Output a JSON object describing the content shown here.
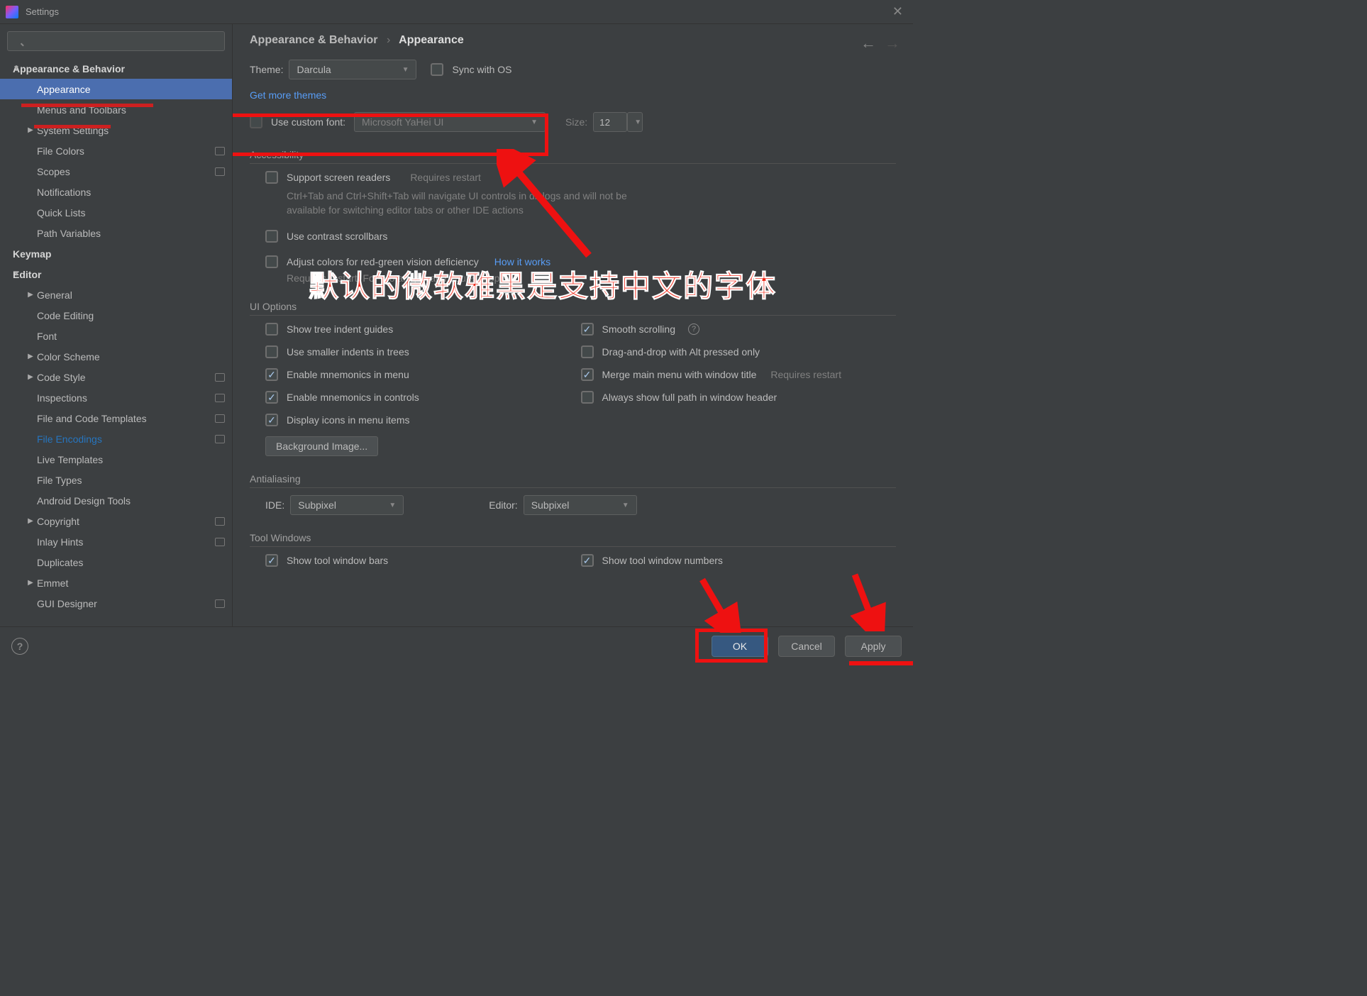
{
  "window": {
    "title": "Settings"
  },
  "sidebar": {
    "items": [
      {
        "label": "Appearance & Behavior",
        "lvl": 0,
        "chev": "down"
      },
      {
        "label": "Appearance",
        "lvl": 1,
        "selected": true
      },
      {
        "label": "Menus and Toolbars",
        "lvl": 1
      },
      {
        "label": "System Settings",
        "lvl": 1,
        "chev": "right"
      },
      {
        "label": "File Colors",
        "lvl": 1,
        "badge": true
      },
      {
        "label": "Scopes",
        "lvl": 1,
        "badge": true
      },
      {
        "label": "Notifications",
        "lvl": 1
      },
      {
        "label": "Quick Lists",
        "lvl": 1
      },
      {
        "label": "Path Variables",
        "lvl": 1
      },
      {
        "label": "Keymap",
        "lvl": 0
      },
      {
        "label": "Editor",
        "lvl": 0,
        "chev": "down"
      },
      {
        "label": "General",
        "lvl": 1,
        "chev": "right"
      },
      {
        "label": "Code Editing",
        "lvl": 1
      },
      {
        "label": "Font",
        "lvl": 1
      },
      {
        "label": "Color Scheme",
        "lvl": 1,
        "chev": "right"
      },
      {
        "label": "Code Style",
        "lvl": 1,
        "chev": "right",
        "badge": true
      },
      {
        "label": "Inspections",
        "lvl": 1,
        "badge": true
      },
      {
        "label": "File and Code Templates",
        "lvl": 1,
        "badge": true
      },
      {
        "label": "File Encodings",
        "lvl": 1,
        "badge": true,
        "highlighted": true
      },
      {
        "label": "Live Templates",
        "lvl": 1
      },
      {
        "label": "File Types",
        "lvl": 1
      },
      {
        "label": "Android Design Tools",
        "lvl": 1
      },
      {
        "label": "Copyright",
        "lvl": 1,
        "chev": "right",
        "badge": true
      },
      {
        "label": "Inlay Hints",
        "lvl": 1,
        "badge": true
      },
      {
        "label": "Duplicates",
        "lvl": 1
      },
      {
        "label": "Emmet",
        "lvl": 1,
        "chev": "right"
      },
      {
        "label": "GUI Designer",
        "lvl": 1,
        "badge": true
      }
    ]
  },
  "breadcrumb": {
    "parent": "Appearance & Behavior",
    "current": "Appearance"
  },
  "theme": {
    "label": "Theme:",
    "value": "Darcula",
    "sync": "Sync with OS",
    "more": "Get more themes"
  },
  "customFont": {
    "label": "Use custom font:",
    "value": "Microsoft YaHei UI",
    "sizeLabel": "Size:",
    "size": "12"
  },
  "accessibility": {
    "title": "Accessibility",
    "screenReaders": "Support screen readers",
    "requiresRestart": "Requires restart",
    "screenReadersHint": "Ctrl+Tab and Ctrl+Shift+Tab will navigate UI controls in dialogs and will not be available for switching editor tabs or other IDE actions",
    "contrast": "Use contrast scrollbars",
    "adjustColors": "Adjust colors for red-green vision deficiency",
    "howItWorks": "How it works",
    "adjustHint": "Requires restart. For protanopia and deuteranopia."
  },
  "uiOptions": {
    "title": "UI Options",
    "treeIndent": "Show tree indent guides",
    "smallerIndents": "Use smaller indents in trees",
    "mnemonicsMenu": "Enable mnemonics in menu",
    "mnemonicsControls": "Enable mnemonics in controls",
    "displayIcons": "Display icons in menu items",
    "smoothScrolling": "Smooth scrolling",
    "dragDrop": "Drag-and-drop with Alt pressed only",
    "mergeMenu": "Merge main menu with window title",
    "fullPath": "Always show full path in window header",
    "bgImage": "Background Image..."
  },
  "antialiasing": {
    "title": "Antialiasing",
    "ide": "IDE:",
    "ideVal": "Subpixel",
    "editor": "Editor:",
    "editorVal": "Subpixel"
  },
  "toolWindows": {
    "title": "Tool Windows",
    "showBars": "Show tool window bars",
    "showNumbers": "Show tool window numbers"
  },
  "footer": {
    "ok": "OK",
    "cancel": "Cancel",
    "apply": "Apply"
  },
  "annotation": {
    "text": "默认的微软雅黑是支持中文的字体"
  }
}
